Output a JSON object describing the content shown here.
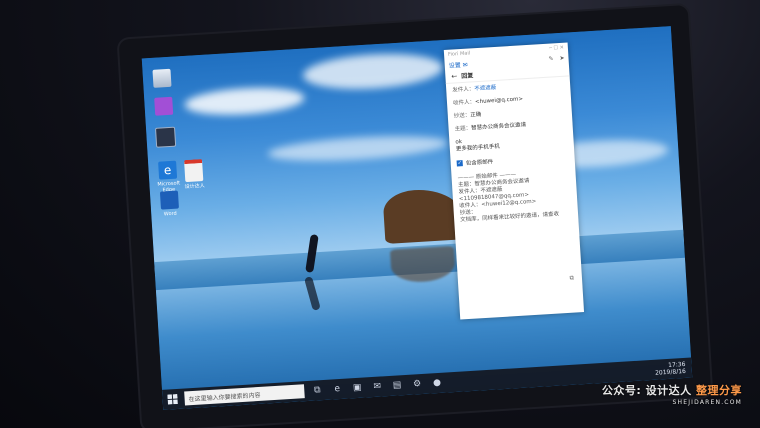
{
  "desktop_icons": [
    {
      "name": "recycle-bin-icon",
      "label": ""
    },
    {
      "name": "app-purple-icon",
      "label": ""
    },
    {
      "name": "app-dark-icon",
      "label": ""
    },
    {
      "name": "edge-icon",
      "label": "Microsoft Edge"
    },
    {
      "name": "pdf-icon",
      "label": "设计达人"
    },
    {
      "name": "app-blue-icon",
      "label": "Word"
    }
  ],
  "mail": {
    "titlebar": "Fiori Mail",
    "account": "设置 ✉",
    "header_title": "回复",
    "from_label": "发件人：",
    "from_value": "不遮遮蔽",
    "to_label": "收件人：",
    "to_value": "<huwei@q.com>",
    "cc_label": "抄送：",
    "cc_value": "正确",
    "subject_label": "主题：",
    "subject_value": "智慧办公商务会议邀请",
    "body_line1": "ok",
    "body_line2": "更多我的手机手机",
    "check_label": "包含原邮件",
    "orig_header": "——— 原始邮件 ———",
    "orig_lines": [
      "主题：智慧办公商务会议邀请",
      "发件人：不遮遮蔽 <1109818047@qq.com>",
      "收件人：<huwei12@q.com>",
      "抄送：",
      "文档库，同样看来比较好的邀请，请查收"
    ]
  },
  "taskbar": {
    "search_placeholder": "在这里输入你要搜索的内容",
    "time": "17:36",
    "date": "2019/8/16"
  },
  "watermark": {
    "prefix": "公众号:",
    "brand": "设计达人",
    "suffix": "整理分享",
    "url": "SHEJIDAREN.COM"
  }
}
